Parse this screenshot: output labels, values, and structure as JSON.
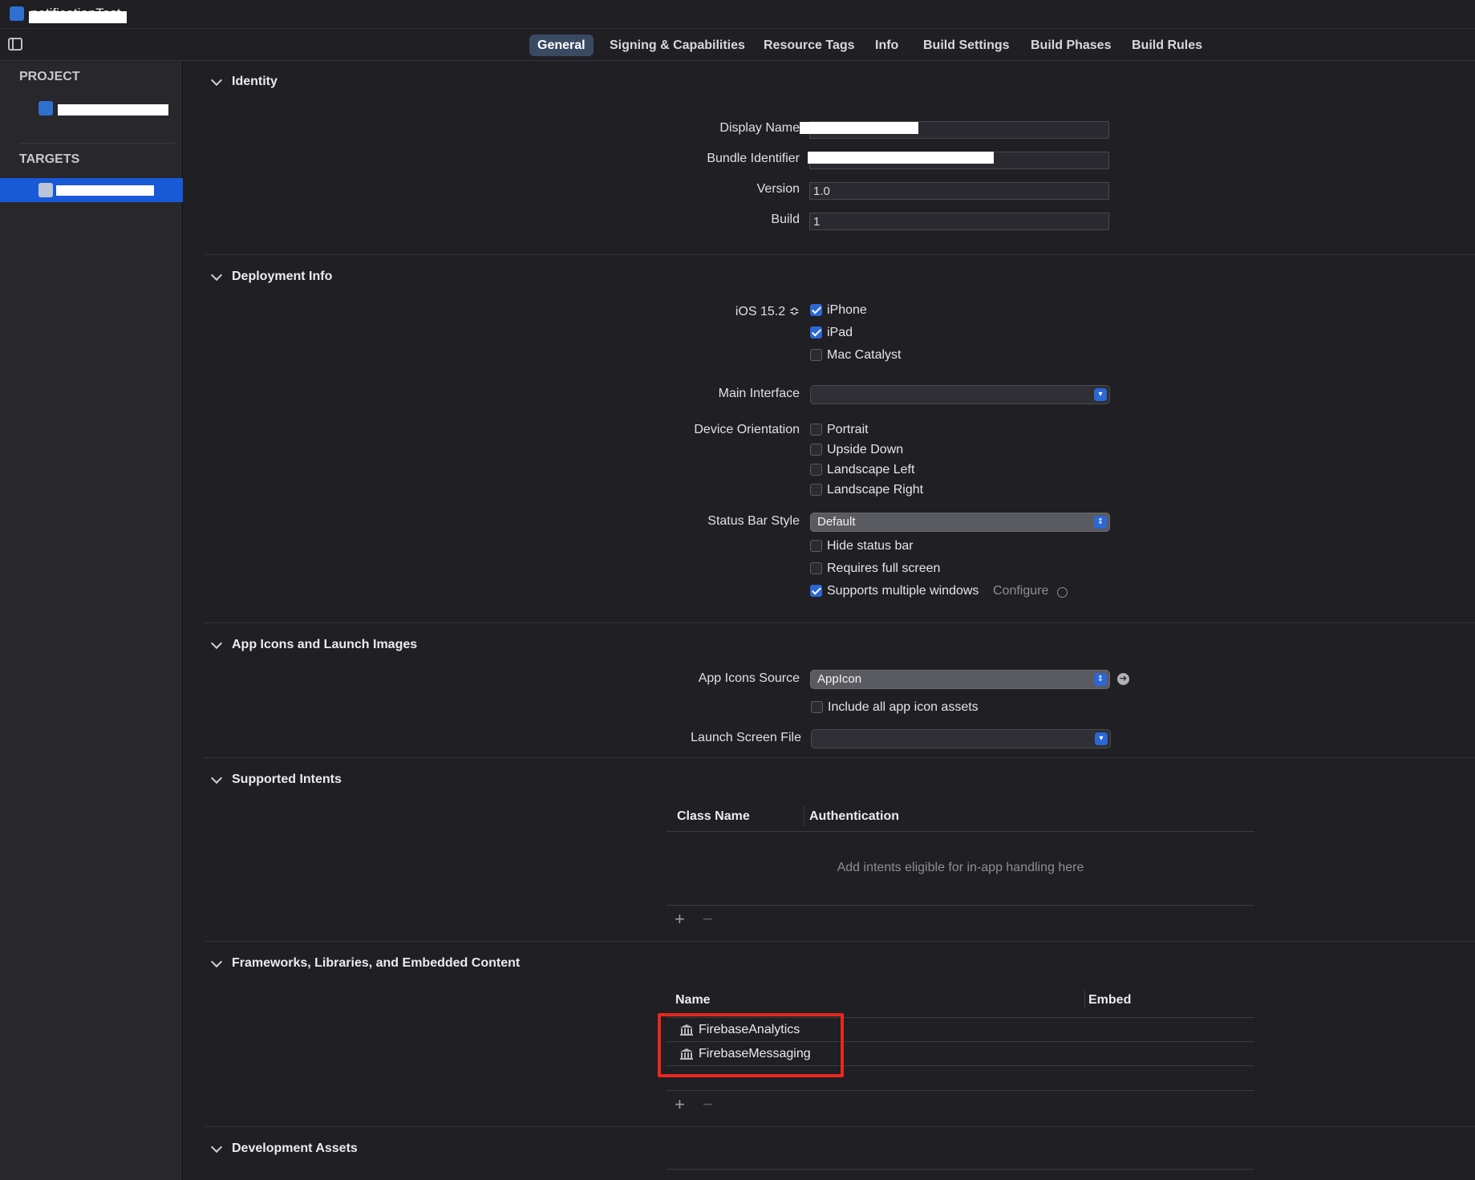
{
  "window": {
    "title": "notificationTest"
  },
  "tabs": [
    "General",
    "Signing & Capabilities",
    "Resource Tags",
    "Info",
    "Build Settings",
    "Build Phases",
    "Build Rules"
  ],
  "sidebar": {
    "project_header": "PROJECT",
    "targets_header": "TARGETS"
  },
  "identity": {
    "header": "Identity",
    "display_name_label": "Display Name",
    "bundle_identifier_label": "Bundle Identifier",
    "version_label": "Version",
    "version_value": "1.0",
    "build_label": "Build",
    "build_value": "1"
  },
  "deployment": {
    "header": "Deployment Info",
    "ios_version": "iOS 15.2 ≎",
    "devices": [
      {
        "label": "iPhone",
        "checked": true
      },
      {
        "label": "iPad",
        "checked": true
      },
      {
        "label": "Mac Catalyst",
        "checked": false
      }
    ],
    "main_interface_label": "Main Interface",
    "device_orientation_label": "Device Orientation",
    "orientations": [
      "Portrait",
      "Upside Down",
      "Landscape Left",
      "Landscape Right"
    ],
    "status_bar_style_label": "Status Bar Style",
    "status_bar_style_value": "Default",
    "hide_status_bar": "Hide status bar",
    "requires_full_screen": "Requires full screen",
    "supports_multiple_windows": "Supports multiple windows",
    "configure": "Configure"
  },
  "app_icons": {
    "header": "App Icons and Launch Images",
    "source_label": "App Icons Source",
    "source_value": "AppIcon",
    "include_all": "Include all app icon assets",
    "launch_screen_label": "Launch Screen File"
  },
  "intents": {
    "header": "Supported Intents",
    "col_class": "Class Name",
    "col_auth": "Authentication",
    "empty_text": "Add intents eligible for in-app handling here"
  },
  "frameworks": {
    "header": "Frameworks, Libraries, and Embedded Content",
    "col_name": "Name",
    "col_embed": "Embed",
    "items": [
      "FirebaseAnalytics",
      "FirebaseMessaging"
    ]
  },
  "dev_assets": {
    "header": "Development Assets"
  },
  "controls": {
    "plus": "+",
    "minus": "−"
  },
  "colors": {
    "accent": "#2c67d6",
    "highlight": "#e8271f",
    "background": "#1f1f24"
  }
}
